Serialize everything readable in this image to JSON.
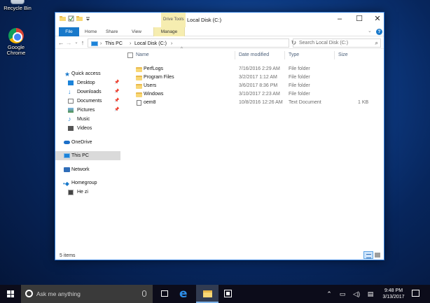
{
  "desktop": {
    "icons": [
      {
        "label": "Recycle Bin"
      },
      {
        "label": "Google Chrome"
      }
    ]
  },
  "window": {
    "title": "Local Disk (C:)",
    "context_group": "Drive Tools",
    "buttons": {
      "minimize": "–",
      "maximize": "☐",
      "close": "✕"
    },
    "ribbon_tabs": {
      "file": "File",
      "home": "Home",
      "share": "Share",
      "view": "View",
      "manage": "Manage"
    },
    "help": "?"
  },
  "navigation": {
    "address_crumbs": [
      "This PC",
      "Local Disk (C:)"
    ],
    "search_placeholder": "Search Local Disk (C:)"
  },
  "sidebar": {
    "quick_access": {
      "label": "Quick access",
      "items": [
        {
          "label": "Desktop",
          "pinned": true
        },
        {
          "label": "Downloads",
          "pinned": true
        },
        {
          "label": "Documents",
          "pinned": true
        },
        {
          "label": "Pictures",
          "pinned": true
        },
        {
          "label": "Music",
          "pinned": false
        },
        {
          "label": "Videos",
          "pinned": false
        }
      ]
    },
    "onedrive": "OneDrive",
    "this_pc": "This PC",
    "network": "Network",
    "homegroup": "Homegroup",
    "user": "He zi"
  },
  "file_list": {
    "columns": [
      "Name",
      "Date modified",
      "Type",
      "Size"
    ],
    "rows": [
      {
        "name": "PerfLogs",
        "date": "7/16/2016 2:29 AM",
        "type": "File folder",
        "size": "",
        "kind": "folder"
      },
      {
        "name": "Program Files",
        "date": "3/2/2017 1:12 AM",
        "type": "File folder",
        "size": "",
        "kind": "folder"
      },
      {
        "name": "Users",
        "date": "3/6/2017 8:36 PM",
        "type": "File folder",
        "size": "",
        "kind": "folder"
      },
      {
        "name": "Windows",
        "date": "3/10/2017 2:23 AM",
        "type": "File folder",
        "size": "",
        "kind": "folder"
      },
      {
        "name": "oem8",
        "date": "10/8/2016 12:26 AM",
        "type": "Text Document",
        "size": "1 KB",
        "kind": "document"
      }
    ]
  },
  "status": {
    "item_count": "5 items"
  },
  "taskbar": {
    "search_placeholder": "Ask me anything",
    "clock_time": "9:48 PM",
    "clock_date": "3/13/2017"
  },
  "colors": {
    "accent": "#1979ca",
    "context_tab": "#f6edb0",
    "folder": "#f8d775",
    "taskbar": "#0c0c1a"
  }
}
